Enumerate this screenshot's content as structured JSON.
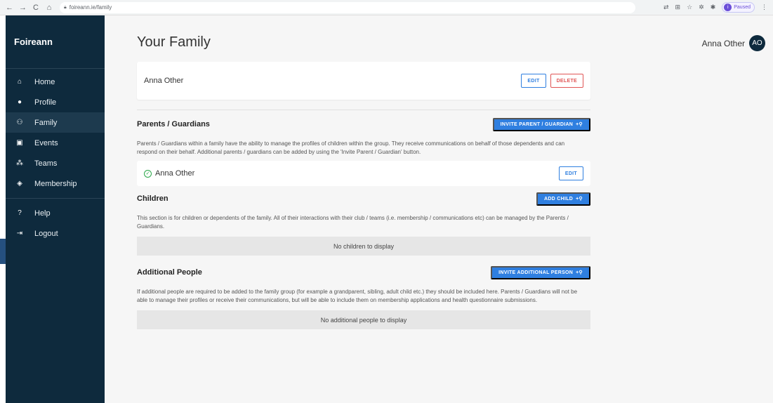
{
  "browser": {
    "url": "foireann.ie/family",
    "profile_badge": "Paused",
    "profile_initial": "i"
  },
  "sidebar": {
    "brand": "Foireann",
    "items": [
      {
        "label": "Home",
        "icon": "home-icon"
      },
      {
        "label": "Profile",
        "icon": "person-icon"
      },
      {
        "label": "Family",
        "icon": "family-icon",
        "active": true
      },
      {
        "label": "Events",
        "icon": "calendar-icon"
      },
      {
        "label": "Teams",
        "icon": "group-icon"
      },
      {
        "label": "Membership",
        "icon": "shield-icon"
      }
    ],
    "footer_items": [
      {
        "label": "Help",
        "icon": "help-icon"
      },
      {
        "label": "Logout",
        "icon": "logout-icon"
      }
    ]
  },
  "header": {
    "title": "Your Family",
    "user_name": "Anna Other",
    "avatar_initials": "AO"
  },
  "family_card": {
    "name": "Anna Other",
    "edit_label": "EDIT",
    "delete_label": "DELETE"
  },
  "parents": {
    "title": "Parents / Guardians",
    "button_label": "INVITE PARENT / GUARDIAN",
    "description": "Parents / Guardians within a family have the ability to manage the profiles of children within the group. They receive communications on behalf of those dependents and can respond on their behalf. Additional parents / guardians can be added by using the 'Invite Parent / Guardian' button.",
    "members": [
      {
        "name": "Anna Other",
        "edit_label": "EDIT"
      }
    ]
  },
  "children": {
    "title": "Children",
    "button_label": "ADD CHILD",
    "description": "This section is for children or dependents of the family. All of their interactions with their club / teams (i.e. membership / communications etc) can be managed by the Parents / Guardians.",
    "empty_text": "No children to display"
  },
  "additional": {
    "title": "Additional People",
    "button_label": "INVITE ADDITIONAL PERSON",
    "description": "If additional people are required to be added to the family group (for example a grandparent, sibling, adult child etc.) they should be included here. Parents / Guardians will not be able to manage their profiles or receive their communications, but will be able to include them on membership applications and health questionnaire submissions.",
    "empty_text": "No additional people to display"
  },
  "colors": {
    "sidebar_bg": "#0e2a3d",
    "primary": "#2f7fe0",
    "danger": "#e05555",
    "success": "#2ba84a"
  }
}
